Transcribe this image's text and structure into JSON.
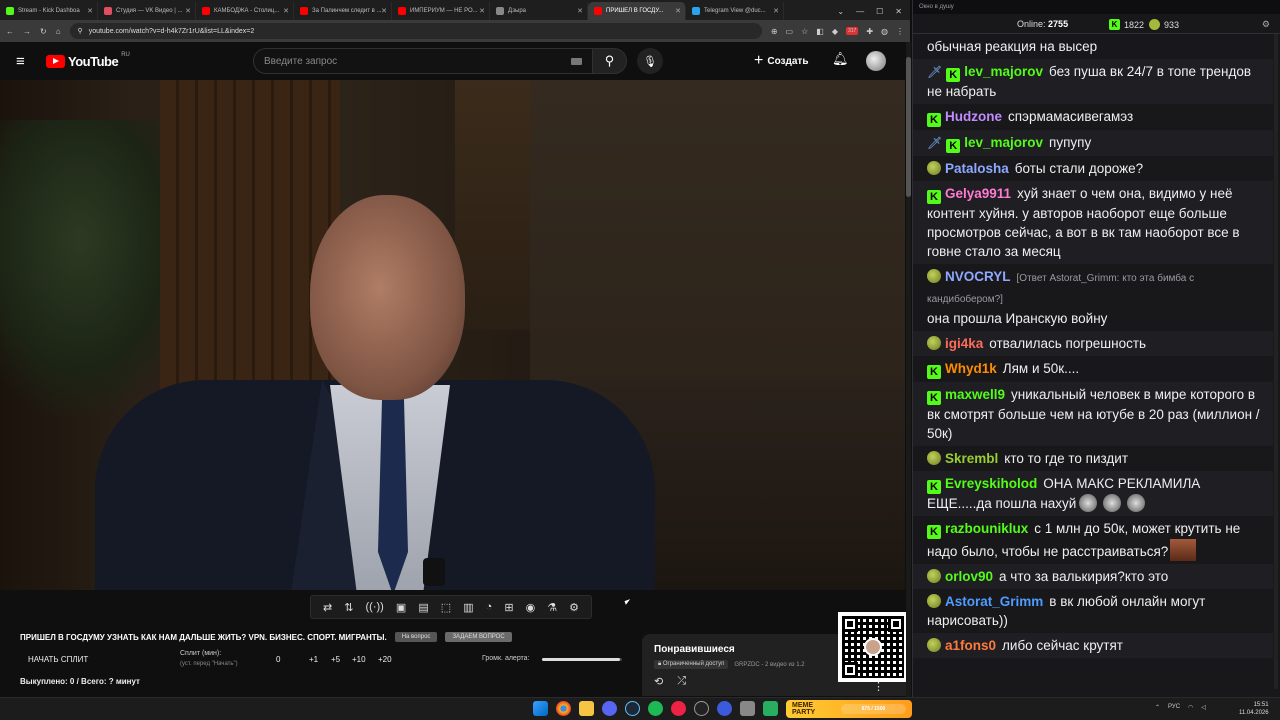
{
  "browser": {
    "tabs": [
      {
        "label": "Stream - Kick Dashboa",
        "color": "#53fc18"
      },
      {
        "label": "Студия — VK Видео | ...",
        "color": "#e04f5f"
      },
      {
        "label": "КАМБОДЖА - Столиц...",
        "color": "#ff0000"
      },
      {
        "label": "За Палинчем следит в ...",
        "color": "#ff0000"
      },
      {
        "label": "ИМПЕРИУМ — НЕ РО...",
        "color": "#ff0000"
      },
      {
        "label": "Дзыра",
        "color": "#888888"
      },
      {
        "label": "ПРИШЕЛ В ГОСДУ...",
        "color": "#ff0000",
        "active": true
      },
      {
        "label": "Telegram View @duc...",
        "color": "#2aa3ef"
      }
    ],
    "url": "youtube.com/watch?v=d-h4k7Zr1rU&list=LL&index=2",
    "ext_badge": "317"
  },
  "youtube": {
    "logo_text": "YouTube",
    "region": "RU",
    "search_placeholder": "Введите запрос",
    "create_label": "Создать"
  },
  "player_controls": [
    "⇄",
    "⇅",
    "((·))",
    "▣",
    "▤",
    "⬚",
    "▥",
    "◔",
    "⊞",
    "◉",
    "⚗",
    "⚙"
  ],
  "video": {
    "title": "ПРИШЕЛ В ГОСДУМУ УЗНАТЬ КАК НАМ ДАЛЬШЕ ЖИТЬ? VPN. БИЗНЕС. СПОРТ. МИГРАНТЫ.",
    "pill1": "На вопрос",
    "pill2": "ЗАДАЕМ ВОПРОС"
  },
  "split": {
    "start_label": "НАЧАТЬ СПЛИТ",
    "split_label": "Сплит (мин):",
    "split_hint": "(уст. перед \"Начать\")",
    "values": [
      "0",
      "+1",
      "+5",
      "+10",
      "+20"
    ],
    "alert_label": "Громк. алерта:",
    "alert_volume": 0.98,
    "bought": "Выкуплено: 0 / Всего: ? минут"
  },
  "playlist": {
    "title": "Понравившиеся",
    "access": "Ограниченный доступ",
    "meta": "GRPZDC - 2 видео из 1.2"
  },
  "chat": {
    "window_title": "Окно в душу",
    "online_label": "Online:",
    "online_count": "2755",
    "count_kick": "1822",
    "count_other": "933",
    "messages": [
      {
        "user": "",
        "color": "#efeff1",
        "text": "обычная реакция на высер",
        "badges": []
      },
      {
        "user": "lev_majorov",
        "color": "#53fc18",
        "text": "без пуша вк 24/7 в топе трендов не набрать",
        "badges": [
          "sword",
          "kick"
        ]
      },
      {
        "user": "Hudzone",
        "color": "#c18bff",
        "text": "спэрмамасивегамэз",
        "badges": [
          "kick"
        ]
      },
      {
        "user": "lev_majorov",
        "color": "#53fc18",
        "text": "пупупу",
        "badges": [
          "sword",
          "kick"
        ]
      },
      {
        "user": "Patalosha",
        "color": "#8fa8ff",
        "text": "боты стали дороже?",
        "badges": [
          "pepe"
        ]
      },
      {
        "user": "Gelya9911",
        "color": "#ff7ad1",
        "text": "хуй знает о чем она, видимо у неё контент хуйня. у авторов наоборот еще больше просмотров сейчас, а вот в вк там наоборот все в говне стало за месяц",
        "badges": [
          "kick"
        ]
      },
      {
        "user": "NVOCRYL",
        "color": "#8fa8ff",
        "text": "она прошла Иранскую войну",
        "reply": "[Ответ Astorat_Grimm: кто эта бимба с кандибобером?]",
        "badges": [
          "pepe"
        ]
      },
      {
        "user": "igi4ka",
        "color": "#ff6b5a",
        "text": "отвалилась погрешность",
        "badges": [
          "pepe"
        ]
      },
      {
        "user": "Whyd1k",
        "color": "#ff8c00",
        "text": "Лям и 50к....",
        "badges": [
          "kick"
        ]
      },
      {
        "user": "maxwell9",
        "color": "#53fc18",
        "text": "уникальный человек в мире которого в вк смотрят больше чем на ютубе в 20 раз (миллион / 50к)",
        "badges": [
          "kick"
        ]
      },
      {
        "user": "Skrembl",
        "color": "#9acd32",
        "text": "кто то где то пиздит",
        "badges": [
          "pepe"
        ]
      },
      {
        "user": "Evreyskiholod",
        "color": "#53fc18",
        "text": "ОНА МАКС РЕКЛАМИЛА ЕЩЕ.....да пошла нахуй",
        "emotes": 3,
        "badges": [
          "kick"
        ]
      },
      {
        "user": "razbouniklux",
        "color": "#53fc18",
        "text": "с 1 млн до 50к, может крутить не надо было, чтобы не расстраиваться?",
        "emote_end": true,
        "badges": [
          "kick"
        ]
      },
      {
        "user": "orlov90",
        "color": "#53fc18",
        "text": "а что за валькирия?кто это",
        "badges": [
          "pepe"
        ]
      },
      {
        "user": "Astorat_Grimm",
        "color": "#4e9cff",
        "text": "в вк любой онлайн могут нарисовать))",
        "badges": [
          "pepe"
        ]
      },
      {
        "user": "a1fons0",
        "color": "#ff7a3d",
        "text": "либо сейчас крутят",
        "badges": [
          "pepe"
        ]
      }
    ]
  },
  "taskbar": {
    "memeparty_label": "MEME PARTY",
    "memeparty_progress": "875 / 1500",
    "lang": "РУС",
    "time": "15:51",
    "date": "11.04.2026"
  }
}
